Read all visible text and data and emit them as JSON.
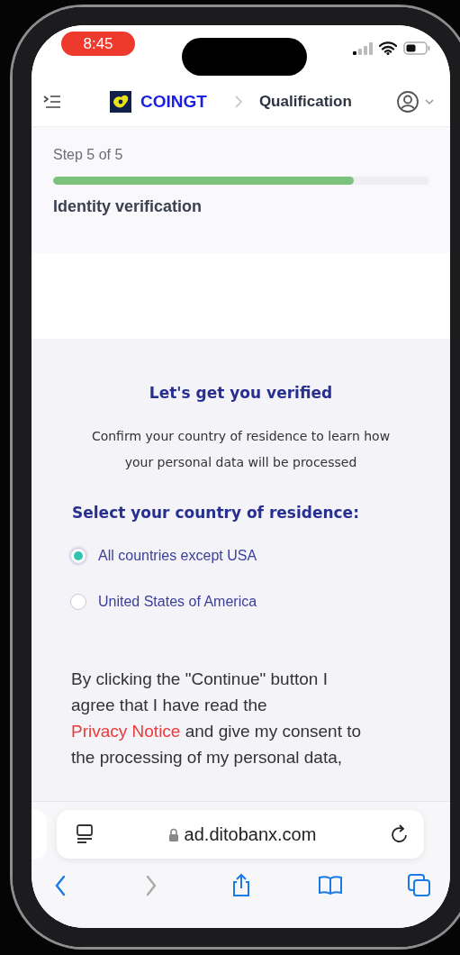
{
  "status_bar": {
    "time": "8:45"
  },
  "header": {
    "brand": "COINGT",
    "breadcrumb": "Qualification"
  },
  "progress": {
    "step": "Step 5 of 5",
    "level": 0.8,
    "title": "Identity verification"
  },
  "verify": {
    "heading": "Let's get you verified",
    "intro": "Confirm your country of residence to learn how your personal data will be processed",
    "question": "Select your country of residence:",
    "options": [
      {
        "label": "All countries except USA",
        "selected": true
      },
      {
        "label": "United States of America",
        "selected": false
      }
    ],
    "consent": {
      "before": "By clicking the \"Continue\" button I agree that I have read the",
      "link": "Privacy Notice",
      "after": "and give my consent to the processing of my personal data,"
    }
  },
  "browser": {
    "url": "ad.ditobanx.com",
    "nav": [
      {
        "kind": "back",
        "disabled": false
      },
      {
        "kind": "forward",
        "disabled": true
      },
      {
        "kind": "share",
        "disabled": false
      },
      {
        "kind": "bookmarks",
        "disabled": false
      },
      {
        "kind": "tabs",
        "disabled": false
      }
    ]
  }
}
